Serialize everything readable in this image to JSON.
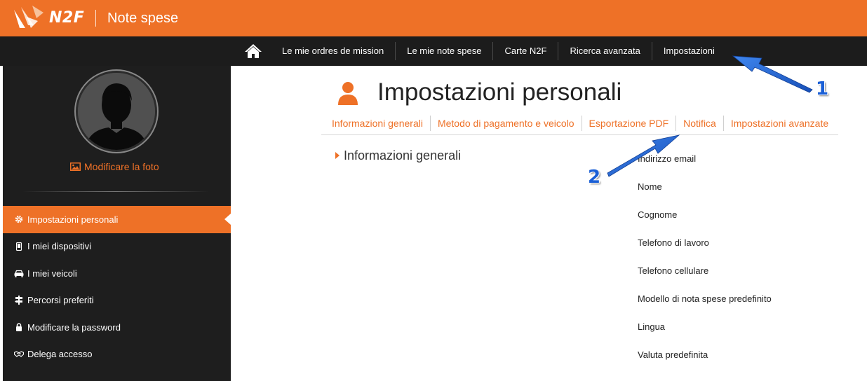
{
  "header": {
    "brand": "N2F",
    "app_title": "Note spese",
    "accent": "#ee7127"
  },
  "nav": {
    "home_icon": "home-icon",
    "items": [
      {
        "label": "Le mie ordres de mission"
      },
      {
        "label": "Le mie note spese"
      },
      {
        "label": "Carte N2F"
      },
      {
        "label": "Ricerca avanzata"
      },
      {
        "label": "Impostazioni"
      }
    ]
  },
  "sidebar": {
    "photo_link": "Modificare la foto",
    "items": [
      {
        "label": "Impostazioni personali",
        "icon": "gear-icon",
        "active": true
      },
      {
        "label": "I miei dispositivi",
        "icon": "mobile-icon"
      },
      {
        "label": "I miei veicoli",
        "icon": "car-icon"
      },
      {
        "label": "Percorsi preferiti",
        "icon": "signpost-icon"
      },
      {
        "label": "Modificare la password",
        "icon": "lock-icon"
      },
      {
        "label": "Delega accesso",
        "icon": "handshake-icon"
      }
    ]
  },
  "main": {
    "title": "Impostazioni personali",
    "tabs": [
      {
        "label": "Informazioni generali"
      },
      {
        "label": "Metodo di pagamento e veicolo"
      },
      {
        "label": "Esportazione PDF"
      },
      {
        "label": "Notifica"
      },
      {
        "label": "Impostazioni avanzate"
      }
    ],
    "section_title": "Informazioni generali",
    "fields": [
      {
        "label": "Indirizzo email"
      },
      {
        "label": "Nome"
      },
      {
        "label": "Cognome"
      },
      {
        "label": "Telefono di lavoro"
      },
      {
        "label": "Telefono cellulare"
      },
      {
        "label": "Modello di nota spese predefinito"
      },
      {
        "label": "Lingua"
      },
      {
        "label": "Valuta predefinita"
      }
    ]
  },
  "annotations": {
    "marker_1": "1",
    "marker_2": "2",
    "color": "#1a5fd6"
  }
}
